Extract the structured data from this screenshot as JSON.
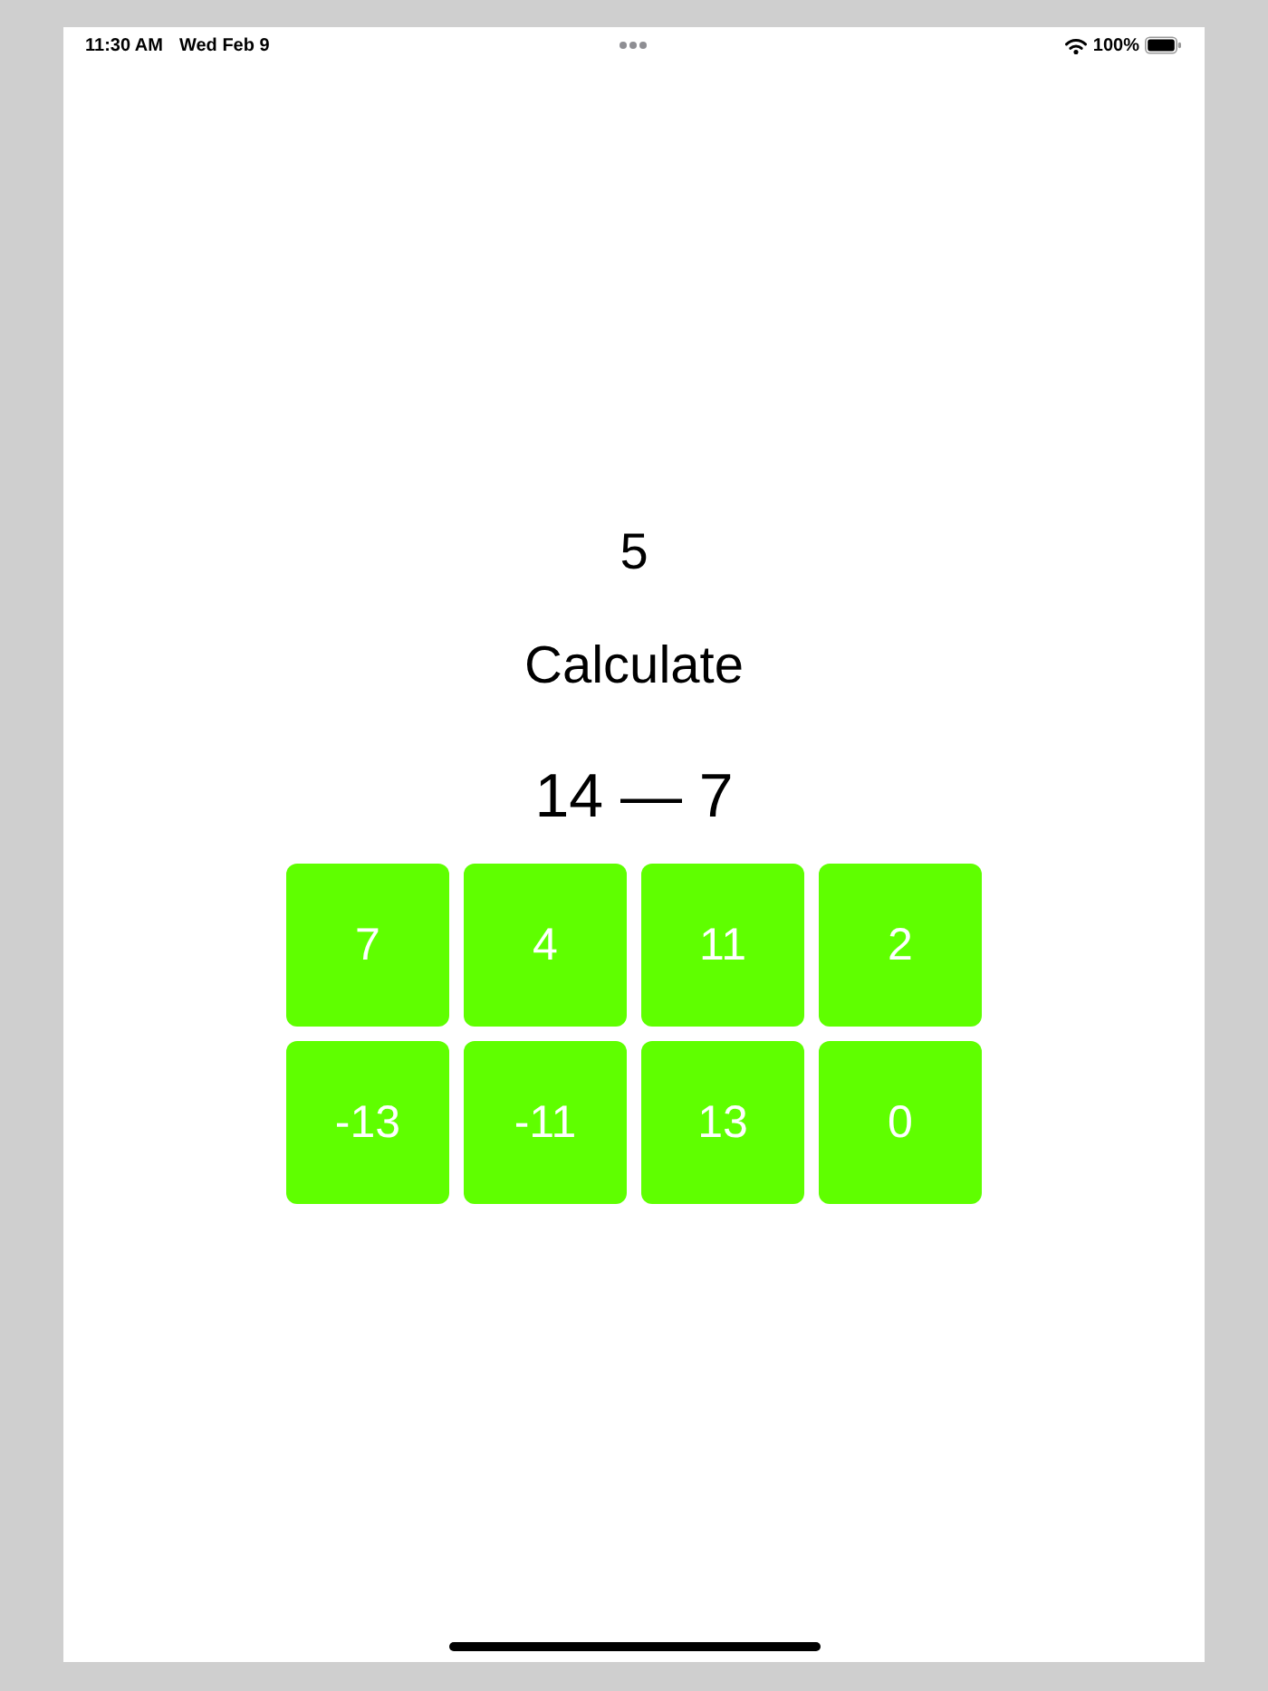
{
  "status_bar": {
    "time": "11:30 AM",
    "date": "Wed Feb 9",
    "battery_text": "100%"
  },
  "score": "5",
  "title": "Calculate",
  "problem": "14 — 7",
  "answers": [
    {
      "label": "7"
    },
    {
      "label": "4"
    },
    {
      "label": "11"
    },
    {
      "label": "2"
    },
    {
      "label": "-13"
    },
    {
      "label": "-11"
    },
    {
      "label": "13"
    },
    {
      "label": "0"
    }
  ]
}
